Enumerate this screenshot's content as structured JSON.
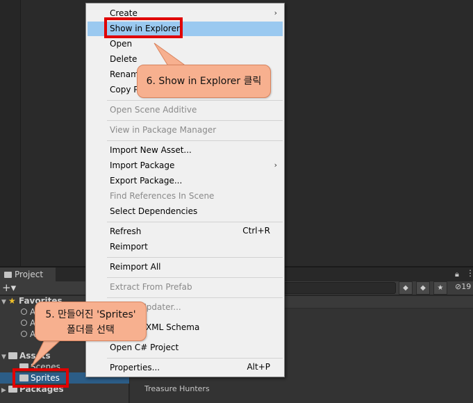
{
  "menu": {
    "create": "Create",
    "show_in_explorer": "Show in Explorer",
    "open": "Open",
    "delete": "Delete",
    "rename": "Rename",
    "copy_path": "Copy P",
    "open_scene_additive": "Open Scene Additive",
    "view_in_package_manager": "View in Package Manager",
    "import_new_asset": "Import New Asset...",
    "import_package": "Import Package",
    "export_package": "Export Package...",
    "find_references": "Find References In Scene",
    "select_dependencies": "Select Dependencies",
    "refresh": "Refresh",
    "refresh_shortcut": "Ctrl+R",
    "reimport": "Reimport",
    "reimport_all": "Reimport All",
    "extract_from_prefab": "Extract From Prefab",
    "updater_fragment": "Updater...",
    "xml_schema_fragment": "XML Schema",
    "open_csharp_project": "Open C# Project",
    "properties": "Properties...",
    "properties_shortcut": "Alt+P"
  },
  "project_panel": {
    "tab_label": "Project",
    "hidden_count": "19",
    "tree": {
      "favorites": "Favorites",
      "fav_item": "A",
      "assets": "Assets",
      "scenes": "Scenes",
      "sprites": "Sprites",
      "packages": "Packages"
    },
    "asset_item": "Treasure Hunters"
  },
  "annotations": {
    "step6": "6. Show in Explorer 클릭",
    "step5_line1": "5. 만들어진 'Sprites'",
    "step5_line2": "폴더를 선택",
    "highlight_color": "#e00000",
    "callout_color": "#f7b08f"
  }
}
